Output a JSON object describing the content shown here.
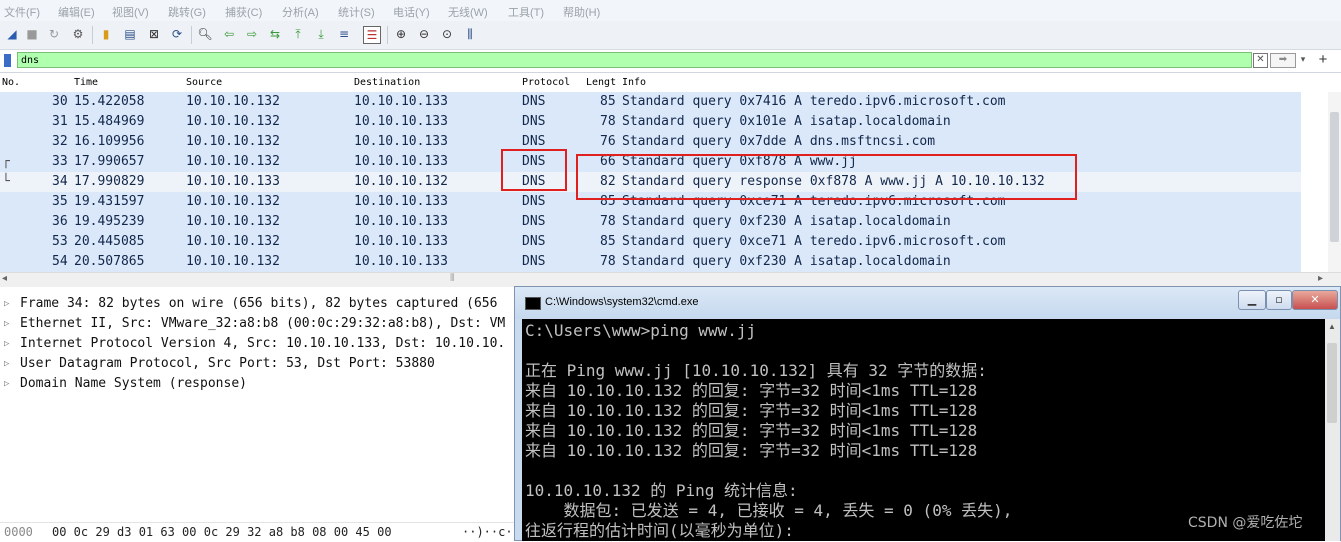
{
  "menu": [
    "文件(F)",
    "编辑(E)",
    "视图(V)",
    "跳转(G)",
    "捕获(C)",
    "分析(A)",
    "统计(S)",
    "电话(Y)",
    "无线(W)",
    "工具(T)",
    "帮助(H)"
  ],
  "filter": {
    "value": "dns"
  },
  "columns": [
    "No.",
    "Time",
    "Source",
    "Destination",
    "Protocol",
    "Lengt",
    "Info"
  ],
  "packets": [
    {
      "no": "30",
      "time": "15.422058",
      "src": "10.10.10.132",
      "dst": "10.10.10.133",
      "proto": "DNS",
      "len": "85",
      "info": "Standard query 0x7416 A teredo.ipv6.microsoft.com"
    },
    {
      "no": "31",
      "time": "15.484969",
      "src": "10.10.10.132",
      "dst": "10.10.10.133",
      "proto": "DNS",
      "len": "78",
      "info": "Standard query 0x101e A isatap.localdomain"
    },
    {
      "no": "32",
      "time": "16.109956",
      "src": "10.10.10.132",
      "dst": "10.10.10.133",
      "proto": "DNS",
      "len": "76",
      "info": "Standard query 0x7dde A dns.msftncsi.com"
    },
    {
      "no": "33",
      "time": "17.990657",
      "src": "10.10.10.132",
      "dst": "10.10.10.133",
      "proto": "DNS",
      "len": "66",
      "info": "Standard query 0xf878 A www.jj"
    },
    {
      "no": "34",
      "time": "17.990829",
      "src": "10.10.10.133",
      "dst": "10.10.10.132",
      "proto": "DNS",
      "len": "82",
      "info": "Standard query response 0xf878 A www.jj A 10.10.10.132"
    },
    {
      "no": "35",
      "time": "19.431597",
      "src": "10.10.10.132",
      "dst": "10.10.10.133",
      "proto": "DNS",
      "len": "85",
      "info": "Standard query 0xce71 A teredo.ipv6.microsoft.com"
    },
    {
      "no": "36",
      "time": "19.495239",
      "src": "10.10.10.132",
      "dst": "10.10.10.133",
      "proto": "DNS",
      "len": "78",
      "info": "Standard query 0xf230 A isatap.localdomain"
    },
    {
      "no": "53",
      "time": "20.445085",
      "src": "10.10.10.132",
      "dst": "10.10.10.133",
      "proto": "DNS",
      "len": "85",
      "info": "Standard query 0xce71 A teredo.ipv6.microsoft.com"
    },
    {
      "no": "54",
      "time": "20.507865",
      "src": "10.10.10.132",
      "dst": "10.10.10.133",
      "proto": "DNS",
      "len": "78",
      "info": "Standard query 0xf230 A isatap.localdomain"
    }
  ],
  "details": [
    "Frame 34: 82 bytes on wire (656 bits), 82 bytes captured (656",
    "Ethernet II, Src: VMware_32:a8:b8 (00:0c:29:32:a8:b8), Dst: VM",
    "Internet Protocol Version 4, Src: 10.10.10.133, Dst: 10.10.10.",
    "User Datagram Protocol, Src Port: 53, Dst Port: 53880",
    "Domain Name System (response)"
  ],
  "bytes": {
    "offset": "0000",
    "hex": "00 0c 29 d3 01 63 00 0c  29 32 a8 b8 08 00 45 00",
    "ascii": "··)··c··"
  },
  "cmd": {
    "title": "C:\\Windows\\system32\\cmd.exe",
    "lines": [
      "C:\\Users\\www>ping www.jj",
      "",
      "正在 Ping www.jj [10.10.10.132] 具有 32 字节的数据:",
      "来自 10.10.10.132 的回复: 字节=32 时间<1ms TTL=128",
      "来自 10.10.10.132 的回复: 字节=32 时间<1ms TTL=128",
      "来自 10.10.10.132 的回复: 字节=32 时间<1ms TTL=128",
      "来自 10.10.10.132 的回复: 字节=32 时间<1ms TTL=128",
      "",
      "10.10.10.132 的 Ping 统计信息:",
      "    数据包: 已发送 = 4, 已接收 = 4, 丢失 = 0 (0% 丢失),",
      "往返行程的估计时间(以毫秒为单位):"
    ]
  },
  "watermark": "CSDN @爱吃佐坨",
  "colors": {
    "row_bg": "#dae8fa",
    "filter_bg": "#afffaf",
    "highlight": "#e0201e",
    "console_bg": "#000000"
  }
}
